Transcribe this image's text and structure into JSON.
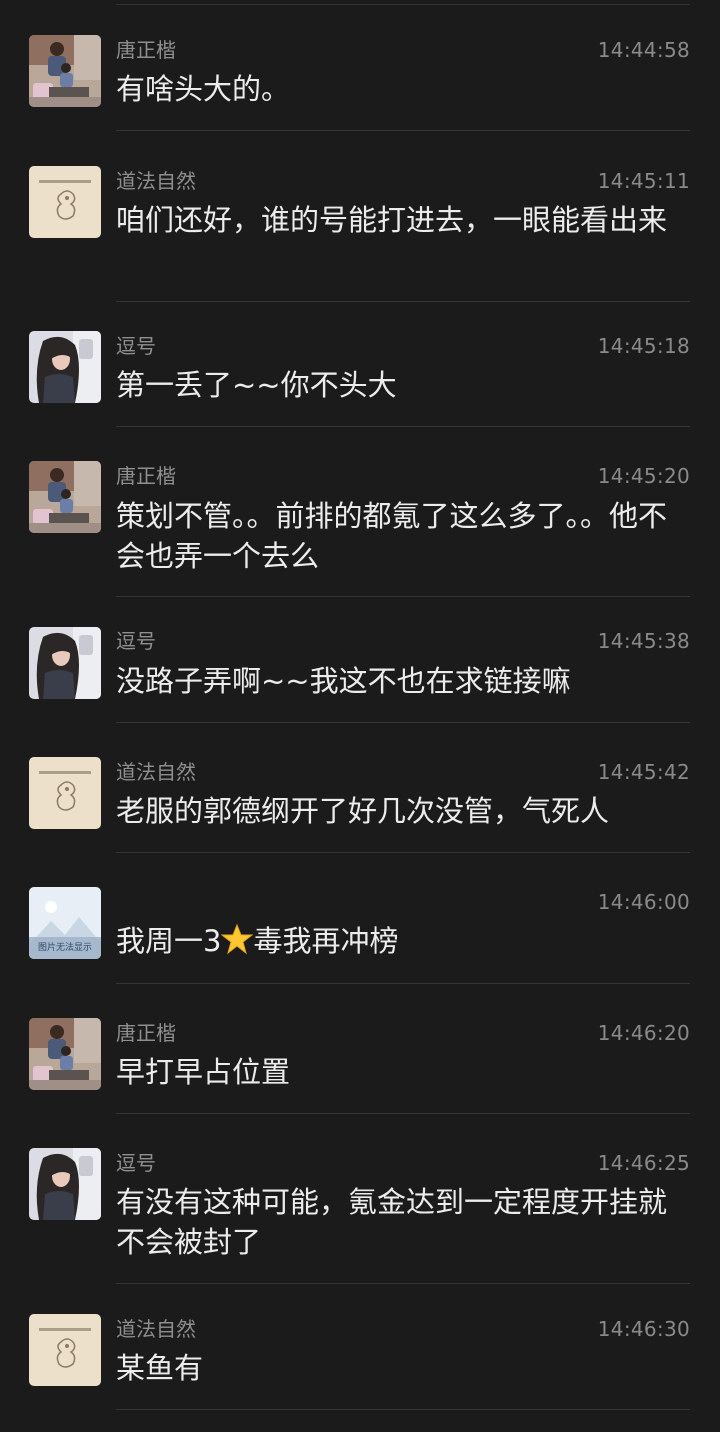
{
  "messages": [
    {
      "name": "唐正楷",
      "time": "14:44:58",
      "text": "有啥头大的。",
      "avatar": "photo-man-child-avatar"
    },
    {
      "name": "道法自然",
      "time": "14:45:11",
      "text": "咱们还好，谁的号能打进去，一眼能看出来",
      "avatar": "sketch-beige-avatar"
    },
    {
      "name": "逗号",
      "time": "14:45:18",
      "text": "第一丢了~~你不头大",
      "avatar": "anime-girl-avatar"
    },
    {
      "name": "唐正楷",
      "time": "14:45:20",
      "text": "策划不管。。前排的都氪了这么多了。。他不会也弄一个去么",
      "avatar": "photo-man-child-avatar"
    },
    {
      "name": "逗号",
      "time": "14:45:38",
      "text": "没路子弄啊~~我这不也在求链接嘛",
      "avatar": "anime-girl-avatar"
    },
    {
      "name": "道法自然",
      "time": "14:45:42",
      "text": "老服的郭德纲开了好几次没管，气死人",
      "avatar": "sketch-beige-avatar"
    },
    {
      "name": "",
      "time": "14:46:00",
      "text_before": "我周一3",
      "text_after": "毒我再冲榜",
      "emoji": "star-emoji",
      "avatar": "landscape-placeholder-avatar",
      "avatar_caption": "图片无法显示"
    },
    {
      "name": "唐正楷",
      "time": "14:46:20",
      "text": "早打早占位置",
      "avatar": "photo-man-child-avatar"
    },
    {
      "name": "逗号",
      "time": "14:46:25",
      "text": "有没有这种可能，氪金达到一定程度开挂就不会被封了",
      "avatar": "anime-girl-avatar"
    },
    {
      "name": "道法自然",
      "time": "14:46:30",
      "text": "某鱼有",
      "avatar": "sketch-beige-avatar"
    }
  ],
  "colors": {
    "background": "#1b1b1b",
    "name": "#8f8f8f",
    "time": "#8a8a8a",
    "text": "#ececec",
    "divider": "#353535"
  }
}
